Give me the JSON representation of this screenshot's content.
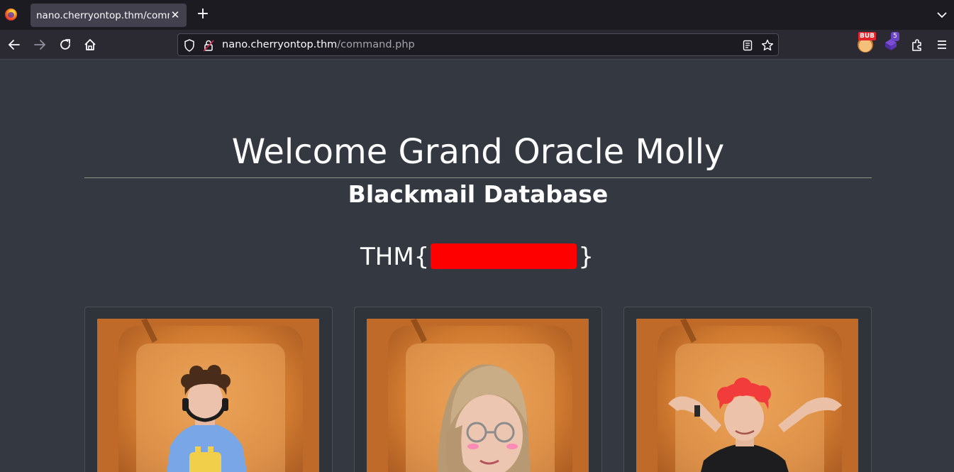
{
  "browser": {
    "tab_title": "nano.cherryontop.thm/command.php",
    "url_host": "nano.cherryontop.thm",
    "url_path": "/command.php",
    "extension_badge_bub": "BUB",
    "extension_badge_count": "5"
  },
  "page": {
    "title": "Welcome Grand Oracle Molly",
    "subtitle": "Blackmail Database",
    "flag_prefix": "THM{",
    "flag_suffix": "}"
  },
  "cards": [
    {
      "person": "curly-haired man with headphones in blue toaster t-shirt"
    },
    {
      "person": "woman with long blonde hair and glasses"
    },
    {
      "person": "man with red hair, arms behind head"
    }
  ],
  "colors": {
    "page_background": "#343840",
    "redaction": "#ff0000",
    "toast": "#d98a3e"
  }
}
